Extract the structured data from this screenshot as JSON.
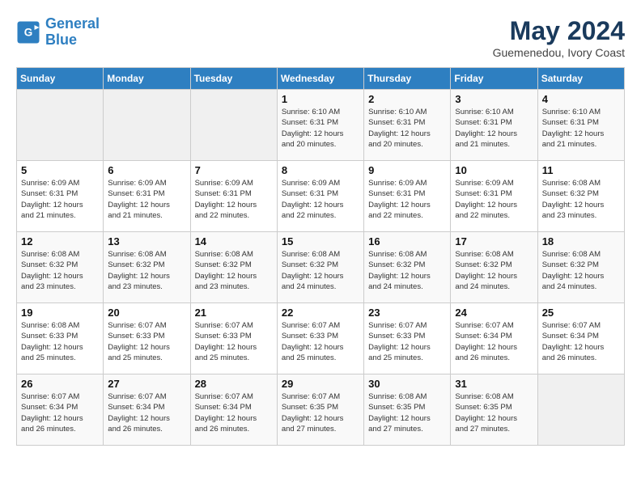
{
  "logo": {
    "line1": "General",
    "line2": "Blue"
  },
  "title": "May 2024",
  "location": "Guemenedou, Ivory Coast",
  "weekdays": [
    "Sunday",
    "Monday",
    "Tuesday",
    "Wednesday",
    "Thursday",
    "Friday",
    "Saturday"
  ],
  "weeks": [
    [
      {
        "day": "",
        "detail": ""
      },
      {
        "day": "",
        "detail": ""
      },
      {
        "day": "",
        "detail": ""
      },
      {
        "day": "1",
        "detail": "Sunrise: 6:10 AM\nSunset: 6:31 PM\nDaylight: 12 hours\nand 20 minutes."
      },
      {
        "day": "2",
        "detail": "Sunrise: 6:10 AM\nSunset: 6:31 PM\nDaylight: 12 hours\nand 20 minutes."
      },
      {
        "day": "3",
        "detail": "Sunrise: 6:10 AM\nSunset: 6:31 PM\nDaylight: 12 hours\nand 21 minutes."
      },
      {
        "day": "4",
        "detail": "Sunrise: 6:10 AM\nSunset: 6:31 PM\nDaylight: 12 hours\nand 21 minutes."
      }
    ],
    [
      {
        "day": "5",
        "detail": "Sunrise: 6:09 AM\nSunset: 6:31 PM\nDaylight: 12 hours\nand 21 minutes."
      },
      {
        "day": "6",
        "detail": "Sunrise: 6:09 AM\nSunset: 6:31 PM\nDaylight: 12 hours\nand 21 minutes."
      },
      {
        "day": "7",
        "detail": "Sunrise: 6:09 AM\nSunset: 6:31 PM\nDaylight: 12 hours\nand 22 minutes."
      },
      {
        "day": "8",
        "detail": "Sunrise: 6:09 AM\nSunset: 6:31 PM\nDaylight: 12 hours\nand 22 minutes."
      },
      {
        "day": "9",
        "detail": "Sunrise: 6:09 AM\nSunset: 6:31 PM\nDaylight: 12 hours\nand 22 minutes."
      },
      {
        "day": "10",
        "detail": "Sunrise: 6:09 AM\nSunset: 6:31 PM\nDaylight: 12 hours\nand 22 minutes."
      },
      {
        "day": "11",
        "detail": "Sunrise: 6:08 AM\nSunset: 6:32 PM\nDaylight: 12 hours\nand 23 minutes."
      }
    ],
    [
      {
        "day": "12",
        "detail": "Sunrise: 6:08 AM\nSunset: 6:32 PM\nDaylight: 12 hours\nand 23 minutes."
      },
      {
        "day": "13",
        "detail": "Sunrise: 6:08 AM\nSunset: 6:32 PM\nDaylight: 12 hours\nand 23 minutes."
      },
      {
        "day": "14",
        "detail": "Sunrise: 6:08 AM\nSunset: 6:32 PM\nDaylight: 12 hours\nand 23 minutes."
      },
      {
        "day": "15",
        "detail": "Sunrise: 6:08 AM\nSunset: 6:32 PM\nDaylight: 12 hours\nand 24 minutes."
      },
      {
        "day": "16",
        "detail": "Sunrise: 6:08 AM\nSunset: 6:32 PM\nDaylight: 12 hours\nand 24 minutes."
      },
      {
        "day": "17",
        "detail": "Sunrise: 6:08 AM\nSunset: 6:32 PM\nDaylight: 12 hours\nand 24 minutes."
      },
      {
        "day": "18",
        "detail": "Sunrise: 6:08 AM\nSunset: 6:32 PM\nDaylight: 12 hours\nand 24 minutes."
      }
    ],
    [
      {
        "day": "19",
        "detail": "Sunrise: 6:08 AM\nSunset: 6:33 PM\nDaylight: 12 hours\nand 25 minutes."
      },
      {
        "day": "20",
        "detail": "Sunrise: 6:07 AM\nSunset: 6:33 PM\nDaylight: 12 hours\nand 25 minutes."
      },
      {
        "day": "21",
        "detail": "Sunrise: 6:07 AM\nSunset: 6:33 PM\nDaylight: 12 hours\nand 25 minutes."
      },
      {
        "day": "22",
        "detail": "Sunrise: 6:07 AM\nSunset: 6:33 PM\nDaylight: 12 hours\nand 25 minutes."
      },
      {
        "day": "23",
        "detail": "Sunrise: 6:07 AM\nSunset: 6:33 PM\nDaylight: 12 hours\nand 25 minutes."
      },
      {
        "day": "24",
        "detail": "Sunrise: 6:07 AM\nSunset: 6:34 PM\nDaylight: 12 hours\nand 26 minutes."
      },
      {
        "day": "25",
        "detail": "Sunrise: 6:07 AM\nSunset: 6:34 PM\nDaylight: 12 hours\nand 26 minutes."
      }
    ],
    [
      {
        "day": "26",
        "detail": "Sunrise: 6:07 AM\nSunset: 6:34 PM\nDaylight: 12 hours\nand 26 minutes."
      },
      {
        "day": "27",
        "detail": "Sunrise: 6:07 AM\nSunset: 6:34 PM\nDaylight: 12 hours\nand 26 minutes."
      },
      {
        "day": "28",
        "detail": "Sunrise: 6:07 AM\nSunset: 6:34 PM\nDaylight: 12 hours\nand 26 minutes."
      },
      {
        "day": "29",
        "detail": "Sunrise: 6:07 AM\nSunset: 6:35 PM\nDaylight: 12 hours\nand 27 minutes."
      },
      {
        "day": "30",
        "detail": "Sunrise: 6:08 AM\nSunset: 6:35 PM\nDaylight: 12 hours\nand 27 minutes."
      },
      {
        "day": "31",
        "detail": "Sunrise: 6:08 AM\nSunset: 6:35 PM\nDaylight: 12 hours\nand 27 minutes."
      },
      {
        "day": "",
        "detail": ""
      }
    ]
  ]
}
